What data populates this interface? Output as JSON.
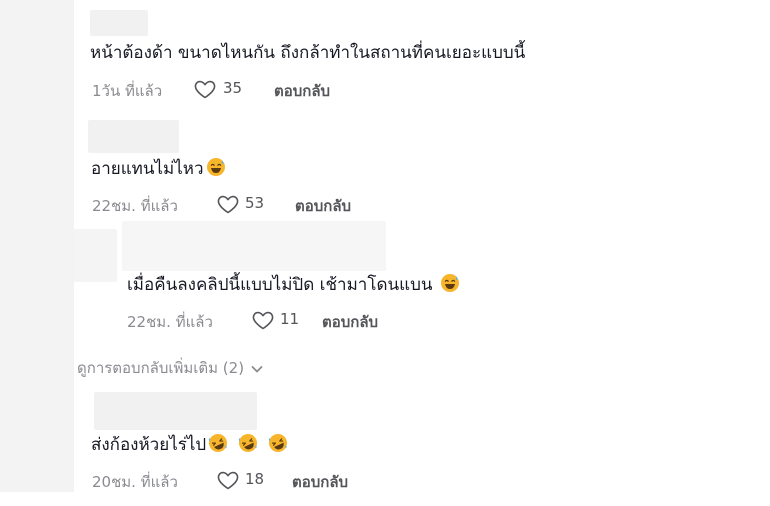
{
  "comments": [
    {
      "text": "หน้าต้องด้า  ขนาดไหนกัน ถึงกล้าทำในสถานที่คนเยอะแบบนี้",
      "time": "1วัน ที่แล้ว",
      "likes": "35",
      "reply_label": "ตอบกลับ",
      "emojis": []
    },
    {
      "text": "อายแทนไม่ไหว",
      "time": "22ชม. ที่แล้ว",
      "likes": "53",
      "reply_label": "ตอบกลับ",
      "emojis": [
        "sweat-smile-emoji"
      ]
    },
    {
      "text": "เมื่อคืนลงคลิปนี้แบบไม่ปิด เช้ามาโดนแบน",
      "time": "22ชม. ที่แล้ว",
      "likes": "11",
      "reply_label": "ตอบกลับ",
      "emojis": [
        "sweat-smile-emoji"
      ]
    },
    {
      "text": "ส่งก้องห้วยไร่ไป",
      "time": "20ชม. ที่แล้ว",
      "likes": "18",
      "reply_label": "ตอบกลับ",
      "emojis": [
        "rofl-emoji",
        "rofl-emoji",
        "rofl-emoji"
      ]
    }
  ],
  "view_more": {
    "label": "ดูการตอบกลับเพิ่มเติม (2)",
    "icon": "chevron-down-icon"
  },
  "icons": {
    "like": "heart-outline-icon"
  },
  "colors": {
    "text_primary": "#161823",
    "text_secondary": "#8a8b91",
    "action": "#545559",
    "emoji_face": "#f7b52c"
  }
}
